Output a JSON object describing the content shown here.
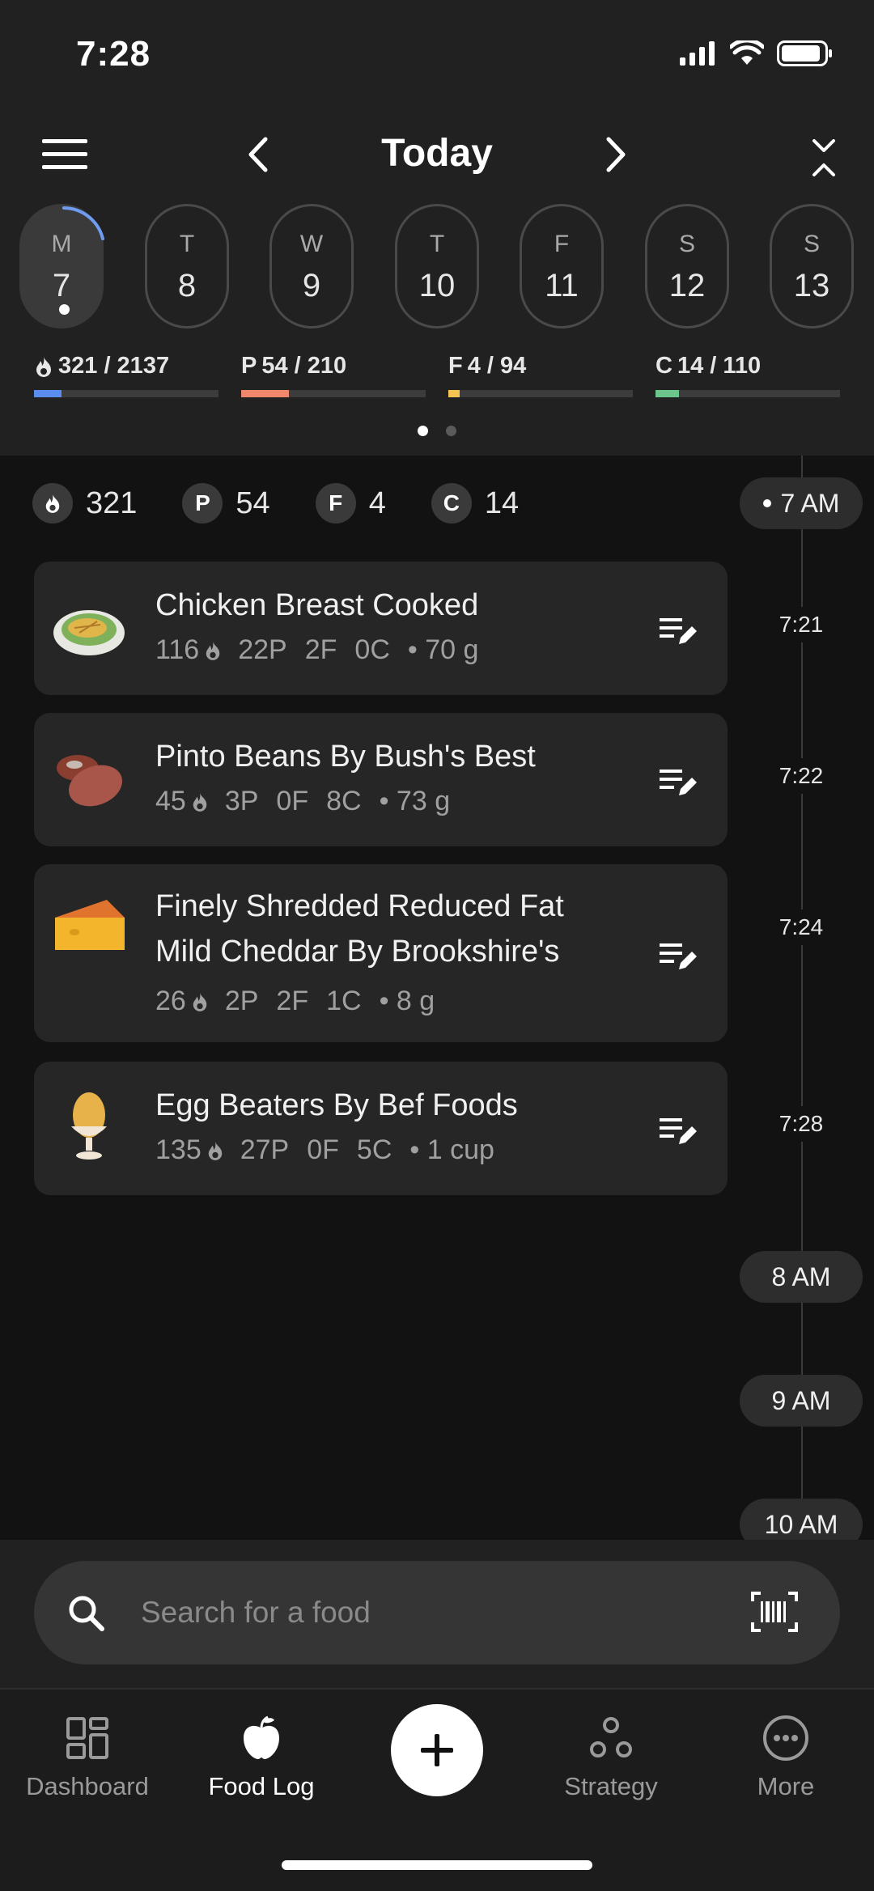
{
  "status": {
    "time": "7:28"
  },
  "header": {
    "title": "Today"
  },
  "days": [
    {
      "letter": "M",
      "num": "7",
      "active": true
    },
    {
      "letter": "T",
      "num": "8"
    },
    {
      "letter": "W",
      "num": "9"
    },
    {
      "letter": "T",
      "num": "10"
    },
    {
      "letter": "F",
      "num": "11"
    },
    {
      "letter": "S",
      "num": "12"
    },
    {
      "letter": "S",
      "num": "13"
    }
  ],
  "macros": {
    "calories": {
      "prefix": "",
      "text": "321 / 2137",
      "value": 321,
      "target": 2137,
      "color": "#5b8def"
    },
    "protein": {
      "prefix": "P",
      "text": "54 / 210",
      "value": 54,
      "target": 210,
      "color": "#f0876a"
    },
    "fat": {
      "prefix": "F",
      "text": "4 / 94",
      "value": 4,
      "target": 94,
      "color": "#f5c451"
    },
    "carbs": {
      "prefix": "C",
      "text": "14 / 110",
      "value": 14,
      "target": 110,
      "color": "#6cc58c"
    }
  },
  "summary": {
    "calories": "321",
    "protein_badge": "P",
    "protein": "54",
    "fat_badge": "F",
    "fat": "4",
    "carbs_badge": "C",
    "carbs": "14"
  },
  "timeline": {
    "hours": [
      "7 AM",
      "8 AM",
      "9 AM",
      "10 AM"
    ]
  },
  "entries": [
    {
      "name": "Chicken Breast Cooked",
      "cal": "116",
      "p": "22P",
      "f": "2F",
      "c": "0C",
      "amount": "• 70 g",
      "time": "7:21"
    },
    {
      "name": "Pinto Beans By Bush's Best",
      "cal": "45",
      "p": "3P",
      "f": "0F",
      "c": "8C",
      "amount": "• 73 g",
      "time": "7:22"
    },
    {
      "name": "Finely Shredded Reduced Fat Mild Cheddar By Brookshire's",
      "cal": "26",
      "p": "2P",
      "f": "2F",
      "c": "1C",
      "amount": "• 8 g",
      "time": "7:24"
    },
    {
      "name": "Egg Beaters By Bef Foods",
      "cal": "135",
      "p": "27P",
      "f": "0F",
      "c": "5C",
      "amount": "• 1 cup",
      "time": "7:28"
    }
  ],
  "search": {
    "placeholder": "Search for a food"
  },
  "tabs": {
    "dashboard": "Dashboard",
    "foodlog": "Food Log",
    "strategy": "Strategy",
    "more": "More"
  }
}
